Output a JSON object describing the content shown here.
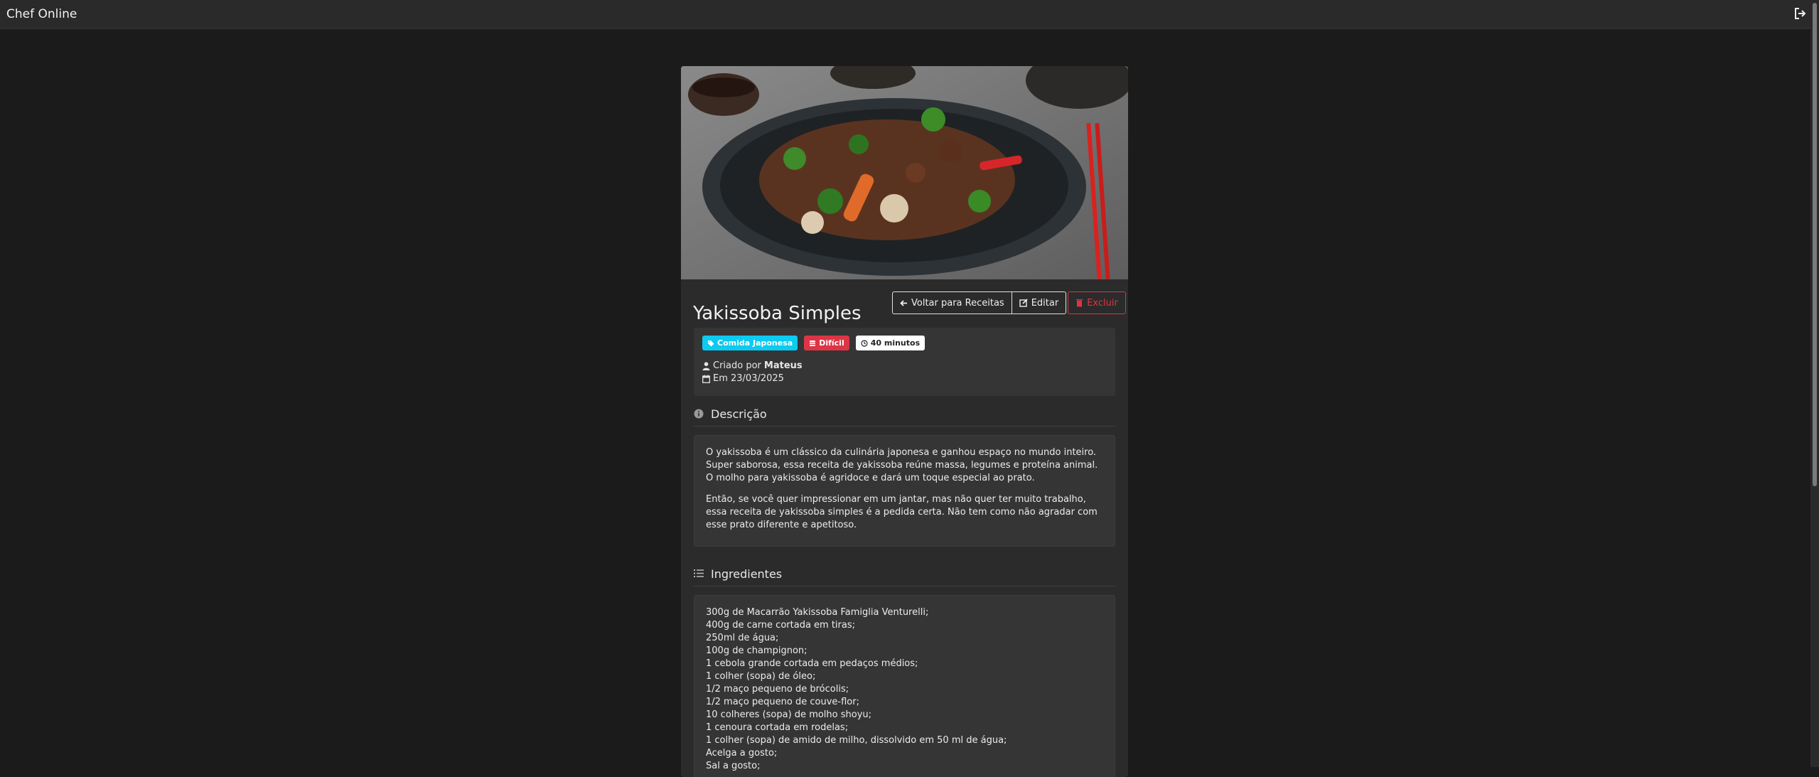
{
  "app": {
    "brand": "Chef Online",
    "logout_icon": "sign-out-icon"
  },
  "recipe": {
    "title": "Yakissoba Simples",
    "actions": {
      "back_label": "Voltar para Receitas",
      "edit_label": "Editar",
      "delete_label": "Excluir"
    },
    "badges": {
      "category": "Comida Japonesa",
      "difficulty": "Difícil",
      "time": "40 minutos"
    },
    "created_by_prefix": "Criado por",
    "author": "Mateus",
    "date_text": "Em 23/03/2025",
    "description_heading": "Descrição",
    "description": [
      "O yakissoba é um clássico da culinária japonesa e ganhou espaço no mundo inteiro. Super saborosa, essa receita de yakissoba reúne massa, legumes e proteína animal. O molho para yakissoba é agridoce e dará um toque especial ao prato.",
      "Então, se você quer impressionar em um jantar, mas não quer ter muito trabalho, essa receita de yakissoba simples é a pedida certa. Não tem como não agradar com esse prato diferente e apetitoso."
    ],
    "ingredients_heading": "Ingredientes",
    "ingredients": [
      "300g de Macarrão Yakissoba Famiglia Venturelli;",
      "400g de carne cortada em tiras;",
      "250ml de água;",
      "100g de champignon;",
      "1 cebola grande cortada em pedaços médios;",
      "1 colher (sopa) de óleo;",
      "1/2 maço pequeno de brócolis;",
      "1/2 maço pequeno de couve-flor;",
      "10 colheres (sopa) de molho shoyu;",
      "1 cenoura cortada em rodelas;",
      "1 colher (sopa) de amido de milho, dissolvido em 50 ml de água;",
      "Acelga a gosto;",
      "Sal a gosto;"
    ]
  },
  "colors": {
    "background": "#1b1b1b",
    "navbar": "#2a2a2a",
    "card": "#2b2b2b",
    "info": "#0dcaf0",
    "danger": "#dc3545"
  }
}
